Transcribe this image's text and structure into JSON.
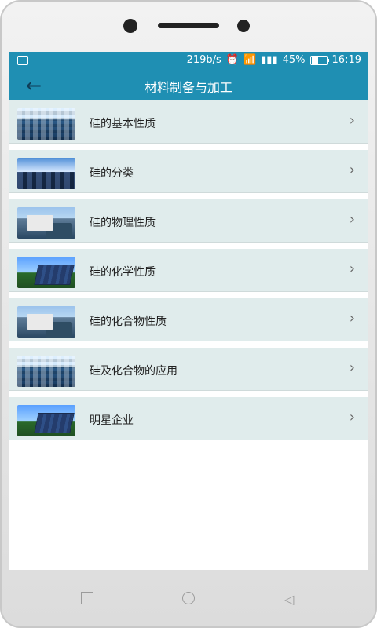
{
  "status_bar": {
    "net_speed": "219b/s",
    "battery_percent": "45%",
    "time": "16:19",
    "battery_level": 0.45,
    "icons": [
      "gallery-icon",
      "alarm-icon",
      "wifi-icon",
      "signal-icon",
      "battery-icon"
    ]
  },
  "header": {
    "back_icon": "arrow-left-icon",
    "title": "材料制备与加工",
    "bg_color": "#1f8fb3"
  },
  "items": [
    {
      "label": "硅的基本性质",
      "thumb": "thumb-solar-field"
    },
    {
      "label": "硅的分类",
      "thumb": "thumb-sky-solar-field"
    },
    {
      "label": "硅的物理性质",
      "thumb": "thumb-roof-work"
    },
    {
      "label": "硅的化学性质",
      "thumb": "thumb-solar-panel"
    },
    {
      "label": "硅的化合物性质",
      "thumb": "thumb-roof-work"
    },
    {
      "label": "硅及化合物的应用",
      "thumb": "thumb-solar-field"
    },
    {
      "label": "明星企业",
      "thumb": "thumb-solar-panel"
    }
  ],
  "chevron": "chevron-right-icon",
  "navigation": {
    "icons": [
      "recent-apps-icon",
      "home-icon",
      "back-icon"
    ]
  }
}
